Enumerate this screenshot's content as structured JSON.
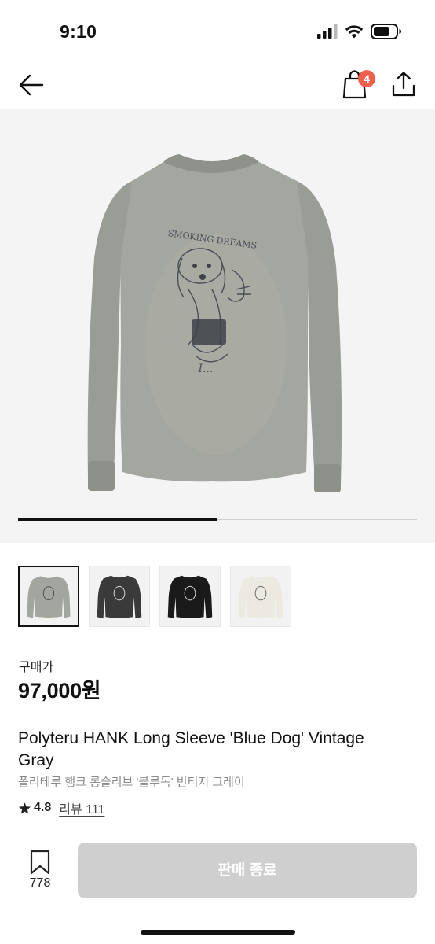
{
  "status_bar": {
    "time": "9:10"
  },
  "nav": {
    "back_icon": "arrow-left-icon",
    "cart_icon": "shopping-bag-icon",
    "cart_count": "4",
    "share_icon": "share-icon"
  },
  "gallery": {
    "carousel_progress": 0.5,
    "thumbnails": [
      {
        "name": "gray",
        "color": "#a3a69e",
        "selected": true
      },
      {
        "name": "charcoal",
        "color": "#3a3a3a",
        "selected": false
      },
      {
        "name": "black",
        "color": "#1a1a1a",
        "selected": false
      },
      {
        "name": "cream",
        "color": "#ece9e0",
        "selected": false
      }
    ],
    "main_image": {
      "print_text": "SMOKING DREAMS",
      "shirt_color": "#a4a79f",
      "background": "#f4f4f4"
    }
  },
  "price": {
    "label": "구매가",
    "value": "97,000원"
  },
  "product": {
    "title_en": "Polyteru HANK Long Sleeve 'Blue Dog' Vintage Gray",
    "title_ko": "폴리테루 행크 롱슬리브 '블루독' 빈티지 그레이",
    "rating": "4.8",
    "review_text": "리뷰 111"
  },
  "bottom_bar": {
    "bookmark_count": "778",
    "cta_label": "판매 종료",
    "cta_color": "#cfcfcf"
  },
  "colors": {
    "badge": "#ef5f4b",
    "text": "#111111"
  }
}
